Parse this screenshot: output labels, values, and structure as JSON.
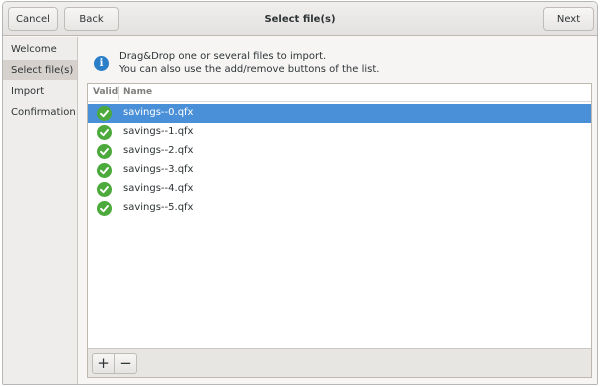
{
  "header": {
    "cancel_label": "Cancel",
    "back_label": "Back",
    "title": "Select file(s)",
    "next_label": "Next"
  },
  "sidebar": {
    "items": [
      {
        "label": "Welcome",
        "active": false
      },
      {
        "label": "Select file(s)",
        "active": true
      },
      {
        "label": "Import",
        "active": false
      },
      {
        "label": "Confirmation",
        "active": false
      }
    ]
  },
  "main": {
    "info_line1": "Drag&Drop one or several files to import.",
    "info_line2": "You can also use the add/remove buttons of the list.",
    "columns": {
      "valid": "Valid",
      "name": "Name"
    },
    "files": [
      {
        "name": "savings--0.qfx",
        "valid": true,
        "selected": true
      },
      {
        "name": "savings--1.qfx",
        "valid": true,
        "selected": false
      },
      {
        "name": "savings--2.qfx",
        "valid": true,
        "selected": false
      },
      {
        "name": "savings--3.qfx",
        "valid": true,
        "selected": false
      },
      {
        "name": "savings--4.qfx",
        "valid": true,
        "selected": false
      },
      {
        "name": "savings--5.qfx",
        "valid": true,
        "selected": false
      }
    ],
    "add_label": "+",
    "remove_label": "−"
  },
  "icons": {
    "info": "info-icon",
    "valid": "check-circle-icon",
    "add": "plus-icon",
    "remove": "minus-icon"
  },
  "colors": {
    "selection": "#4a90d9",
    "valid": "#4caa3c",
    "info": "#2a7fc8"
  }
}
